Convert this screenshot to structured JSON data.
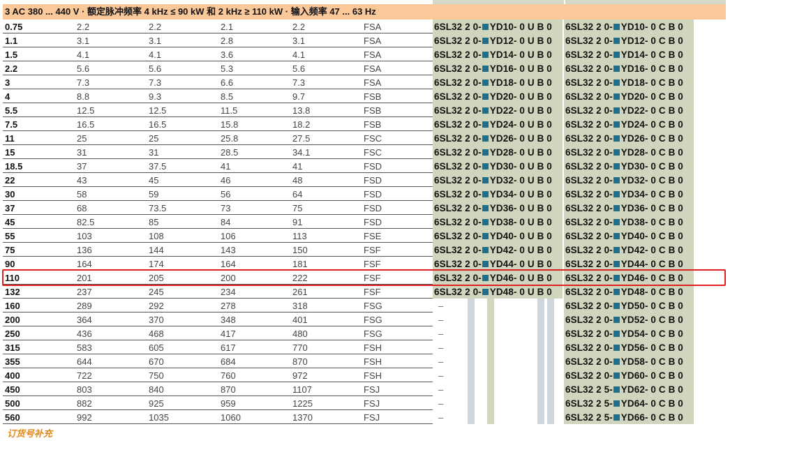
{
  "header": "3 AC 380 ... 440 V · 额定脉冲频率 4 kHz ≤ 90 kW 和 2 kHz ≥ 110 kW · 输入频率  47 ... 63 Hz",
  "footer": "订货号补充",
  "highlight_row": "110",
  "rows": [
    {
      "p": "0.75",
      "a": "2.2",
      "b": "2.2",
      "c": "2.1",
      "d": "2.2",
      "f": "FSA",
      "o1a": "6SL32 2 0-",
      "o1b": "YD10- 0 U B 0",
      "o2a": "6SL32 2 0-",
      "o2b": "YD10- 0 C B 0"
    },
    {
      "p": "1.1",
      "a": "3.1",
      "b": "3.1",
      "c": "2.8",
      "d": "3.1",
      "f": "FSA",
      "o1a": "6SL32 2 0-",
      "o1b": "YD12- 0 U B 0",
      "o2a": "6SL32 2 0-",
      "o2b": "YD12- 0 C B 0"
    },
    {
      "p": "1.5",
      "a": "4.1",
      "b": "4.1",
      "c": "3.6",
      "d": "4.1",
      "f": "FSA",
      "o1a": "6SL32 2 0-",
      "o1b": "YD14- 0 U B 0",
      "o2a": "6SL32 2 0-",
      "o2b": "YD14- 0 C B 0"
    },
    {
      "p": "2.2",
      "a": "5.6",
      "b": "5.6",
      "c": "5.3",
      "d": "5.6",
      "f": "FSA",
      "o1a": "6SL32 2 0-",
      "o1b": "YD16- 0 U B 0",
      "o2a": "6SL32 2 0-",
      "o2b": "YD16- 0 C B 0"
    },
    {
      "p": "3",
      "a": "7.3",
      "b": "7.3",
      "c": "6.6",
      "d": "7.3",
      "f": "FSA",
      "o1a": "6SL32 2 0-",
      "o1b": "YD18- 0 U B 0",
      "o2a": "6SL32 2 0-",
      "o2b": "YD18- 0 C B 0"
    },
    {
      "p": "4",
      "a": "8.8",
      "b": "9.3",
      "c": "8.5",
      "d": "9.7",
      "f": "FSB",
      "o1a": "6SL32 2 0-",
      "o1b": "YD20- 0 U B 0",
      "o2a": "6SL32 2 0-",
      "o2b": "YD20- 0 C B 0"
    },
    {
      "p": "5.5",
      "a": "12.5",
      "b": "12.5",
      "c": "11.5",
      "d": "13.8",
      "f": "FSB",
      "o1a": "6SL32 2 0-",
      "o1b": "YD22- 0 U B 0",
      "o2a": "6SL32 2 0-",
      "o2b": "YD22- 0 C B 0"
    },
    {
      "p": "7.5",
      "a": "16.5",
      "b": "16.5",
      "c": "15.8",
      "d": "18.2",
      "f": "FSB",
      "o1a": "6SL32 2 0-",
      "o1b": "YD24- 0 U B 0",
      "o2a": "6SL32 2 0-",
      "o2b": "YD24- 0 C B 0"
    },
    {
      "p": "11",
      "a": "25",
      "b": "25",
      "c": "25.8",
      "d": "27.5",
      "f": "FSC",
      "o1a": "6SL32 2 0-",
      "o1b": "YD26- 0 U B 0",
      "o2a": "6SL32 2 0-",
      "o2b": "YD26- 0 C B 0"
    },
    {
      "p": "15",
      "a": "31",
      "b": "31",
      "c": "28.5",
      "d": "34.1",
      "f": "FSC",
      "o1a": "6SL32 2 0-",
      "o1b": "YD28- 0 U B 0",
      "o2a": "6SL32 2 0-",
      "o2b": "YD28- 0 C B 0"
    },
    {
      "p": "18.5",
      "a": "37",
      "b": "37.5",
      "c": "41",
      "d": "41",
      "f": "FSD",
      "o1a": "6SL32 2 0-",
      "o1b": "YD30- 0 U B 0",
      "o2a": "6SL32 2 0-",
      "o2b": "YD30- 0 C B 0"
    },
    {
      "p": "22",
      "a": "43",
      "b": "45",
      "c": "46",
      "d": "48",
      "f": "FSD",
      "o1a": "6SL32 2 0-",
      "o1b": "YD32- 0 U B 0",
      "o2a": "6SL32 2 0-",
      "o2b": "YD32- 0 C B 0"
    },
    {
      "p": "30",
      "a": "58",
      "b": "59",
      "c": "56",
      "d": "64",
      "f": "FSD",
      "o1a": "6SL32 2 0-",
      "o1b": "YD34- 0 U B 0",
      "o2a": "6SL32 2 0-",
      "o2b": "YD34- 0 C B 0"
    },
    {
      "p": "37",
      "a": "68",
      "b": "73.5",
      "c": "73",
      "d": "75",
      "f": "FSD",
      "o1a": "6SL32 2 0-",
      "o1b": "YD36- 0 U B 0",
      "o2a": "6SL32 2 0-",
      "o2b": "YD36- 0 C B 0"
    },
    {
      "p": "45",
      "a": "82.5",
      "b": "85",
      "c": "84",
      "d": "91",
      "f": "FSD",
      "o1a": "6SL32 2 0-",
      "o1b": "YD38- 0 U B 0",
      "o2a": "6SL32 2 0-",
      "o2b": "YD38- 0 C B 0"
    },
    {
      "p": "55",
      "a": "103",
      "b": "108",
      "c": "106",
      "d": "113",
      "f": "FSE",
      "o1a": "6SL32 2 0-",
      "o1b": "YD40- 0 U B 0",
      "o2a": "6SL32 2 0-",
      "o2b": "YD40- 0 C B 0"
    },
    {
      "p": "75",
      "a": "136",
      "b": "144",
      "c": "143",
      "d": "150",
      "f": "FSF",
      "o1a": "6SL32 2 0-",
      "o1b": "YD42- 0 U B 0",
      "o2a": "6SL32 2 0-",
      "o2b": "YD42- 0 C B 0"
    },
    {
      "p": "90",
      "a": "164",
      "b": "174",
      "c": "164",
      "d": "181",
      "f": "FSF",
      "o1a": "6SL32 2 0-",
      "o1b": "YD44- 0 U B 0",
      "o2a": "6SL32 2 0-",
      "o2b": "YD44- 0 C B 0"
    },
    {
      "p": "110",
      "a": "201",
      "b": "205",
      "c": "200",
      "d": "222",
      "f": "FSF",
      "o1a": "6SL32 2 0-",
      "o1b": "YD46- 0 U B 0",
      "o2a": "6SL32 2 0-",
      "o2b": "YD46- 0 C B 0"
    },
    {
      "p": "132",
      "a": "237",
      "b": "245",
      "c": "234",
      "d": "261",
      "f": "FSF",
      "o1a": "6SL32 2 0-",
      "o1b": "YD48- 0 U B 0",
      "o2a": "6SL32 2 0-",
      "o2b": "YD48- 0 C B 0"
    },
    {
      "p": "160",
      "a": "289",
      "b": "292",
      "c": "278",
      "d": "318",
      "f": "FSG",
      "dash": "–",
      "o2a": "6SL32 2 0-",
      "o2b": "YD50- 0 C B 0"
    },
    {
      "p": "200",
      "a": "364",
      "b": "370",
      "c": "348",
      "d": "401",
      "f": "FSG",
      "dash": "–",
      "o2a": "6SL32 2 0-",
      "o2b": "YD52- 0 C B 0"
    },
    {
      "p": "250",
      "a": "436",
      "b": "468",
      "c": "417",
      "d": "480",
      "f": "FSG",
      "dash": "–",
      "o2a": "6SL32 2 0-",
      "o2b": "YD54- 0 C B 0"
    },
    {
      "p": "315",
      "a": "583",
      "b": "605",
      "c": "617",
      "d": "770",
      "f": "FSH",
      "dash": "–",
      "o2a": "6SL32 2 0-",
      "o2b": "YD56- 0 C B 0"
    },
    {
      "p": "355",
      "a": "644",
      "b": "670",
      "c": "684",
      "d": "870",
      "f": "FSH",
      "dash": "–",
      "o2a": "6SL32 2 0-",
      "o2b": "YD58- 0 C B 0"
    },
    {
      "p": "400",
      "a": "722",
      "b": "750",
      "c": "760",
      "d": "972",
      "f": "FSH",
      "dash": "–",
      "o2a": "6SL32 2 0-",
      "o2b": "YD60- 0 C B 0"
    },
    {
      "p": "450",
      "a": "803",
      "b": "840",
      "c": "870",
      "d": "1107",
      "f": "FSJ",
      "dash": "–",
      "o2a": "6SL32 2 5-",
      "o2b": "YD62- 0 C B 0"
    },
    {
      "p": "500",
      "a": "882",
      "b": "925",
      "c": "959",
      "d": "1225",
      "f": "FSJ",
      "dash": "–",
      "o2a": "6SL32 2 5-",
      "o2b": "YD64- 0 C B 0"
    },
    {
      "p": "560",
      "a": "992",
      "b": "1035",
      "c": "1060",
      "d": "1370",
      "f": "FSJ",
      "dash": "–",
      "o2a": "6SL32 2 5-",
      "o2b": "YD66- 0 C B 0"
    }
  ]
}
